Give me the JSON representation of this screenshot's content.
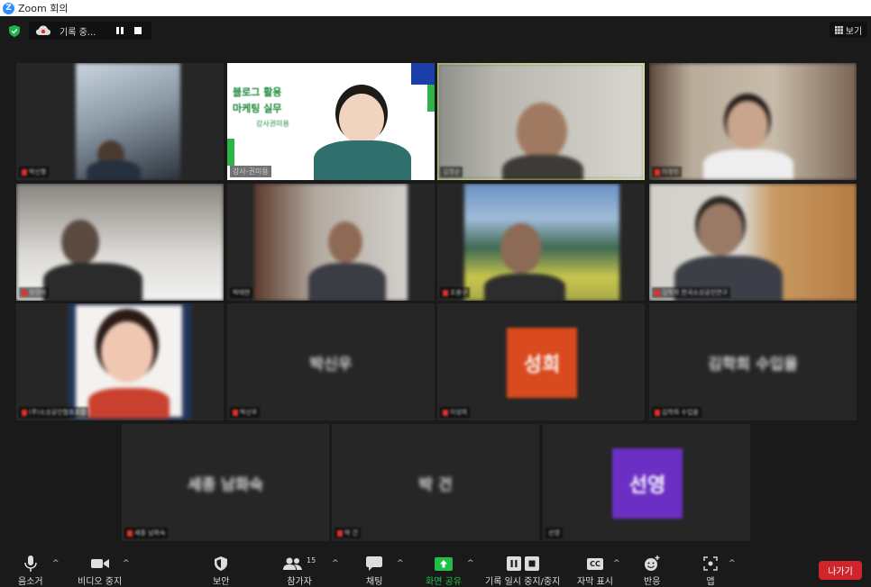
{
  "window": {
    "title": "Zoom 회의"
  },
  "top": {
    "recording_label": "기록 중...",
    "view_label": "보기"
  },
  "tiles": [
    {
      "name": "박신형"
    },
    {
      "name": "강사-권미용",
      "slide_title_1": "블로그 활용",
      "slide_title_2": "마케팅 실무",
      "slide_sub": "강사권미용"
    },
    {
      "name": "김영순"
    },
    {
      "name": "이정민"
    },
    {
      "name": "정영미"
    },
    {
      "name": "박태현"
    },
    {
      "name": "조용구"
    },
    {
      "name": "김학희 한국소상공인연구"
    },
    {
      "name": "(주)소상공인협동조합"
    },
    {
      "name": "박신우",
      "display": "박신우"
    },
    {
      "name": "이성희",
      "display": "성희",
      "avatar_color": "#d94a1e"
    },
    {
      "name": "김학희 수입을",
      "display": "김학희 수입을"
    },
    {
      "name": "세종 남화숙",
      "display": "세종 남화숙"
    },
    {
      "name": "박 건",
      "display": "박 건"
    },
    {
      "name": "선영",
      "display": "선영",
      "avatar_color": "#6b2fc4"
    }
  ],
  "toolbar": {
    "mute": "음소거",
    "video": "비디오 중지",
    "security": "보안",
    "participants": "참가자",
    "participants_count": "15",
    "chat": "채팅",
    "share": "화면 공유",
    "record": "기록 일시 중지/중지",
    "captions": "자막 표시",
    "captions_icon": "CC",
    "reactions": "반응",
    "apps": "앱",
    "leave": "나가기"
  },
  "colors": {
    "share_green": "#1fbf4a",
    "leave_red": "#d1252e",
    "active_border": "#c7e24a"
  }
}
